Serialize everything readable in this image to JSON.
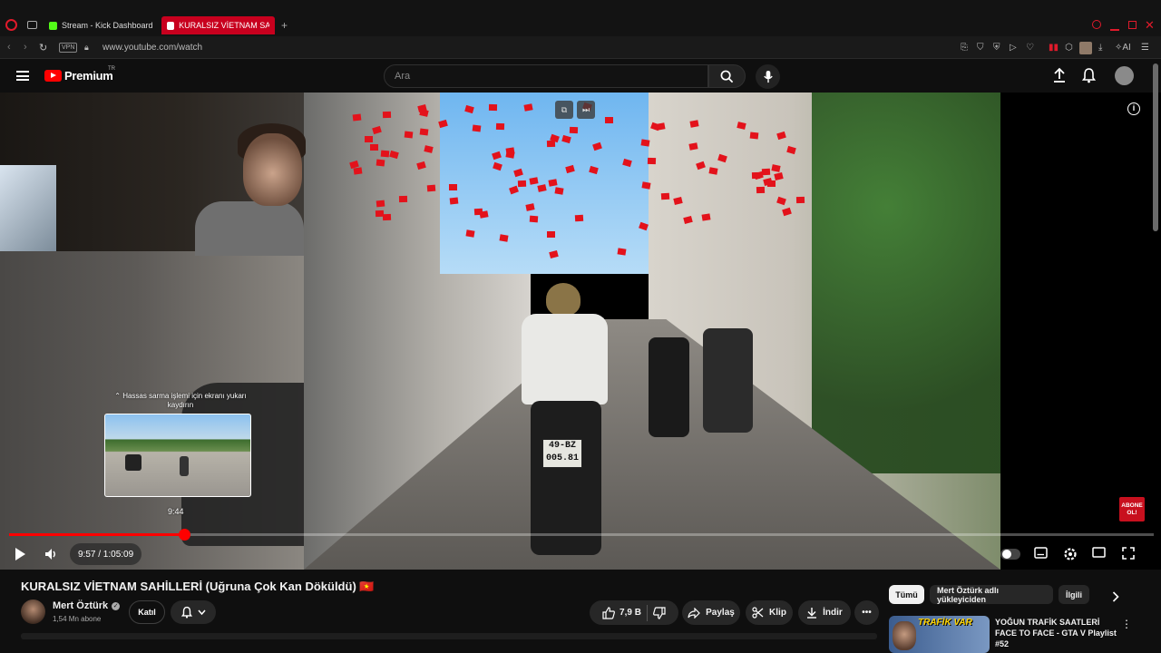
{
  "browser": {
    "tabs": [
      {
        "label": "Stream - Kick Dashboard",
        "favicon_color": "#53fc18"
      },
      {
        "label": "KURALSIZ VİETNAM SAHİ",
        "favicon_color": "#ff0000"
      }
    ],
    "new_tab_label": "+",
    "vpn_label": "VPN",
    "url": "www.youtube.com/watch",
    "ai_label": "AI"
  },
  "yt_header": {
    "logo_text": "Premium",
    "logo_region": "TR",
    "search_placeholder": "Ara"
  },
  "player": {
    "seek_hint": "⌃ Hassas sarma işlemi için ekranı yukarı kaydırın",
    "preview_time": "9:44",
    "time_current": "9:57",
    "time_total": "1:05:09",
    "time_display": "9:57 / 1:05:09",
    "progress_fraction": 0.1528,
    "abone_label": "ABONE OL!",
    "plate_text": "49-BZ\n005.81",
    "accent_color": "#ff0000"
  },
  "video": {
    "title": "KURALSIZ VİETNAM SAHİLLERİ (Uğruna Çok Kan Döküldü) 🇻🇳",
    "channel_name": "Mert Öztürk",
    "subscribers": "1,54 Mn abone",
    "join_label": "Katıl",
    "like_count": "7,9 B",
    "share_label": "Paylaş",
    "clip_label": "Klip",
    "download_label": "İndir"
  },
  "sidebar": {
    "chips": [
      "Tümü",
      "Mert Öztürk adlı yükleyiciden",
      "İlgili"
    ],
    "rec_thumb_text": "TRAFİK VAR",
    "rec_title": "YOĞUN TRAFİK SAATLERİ FACE TO FACE - GTA V Playlist #52"
  }
}
